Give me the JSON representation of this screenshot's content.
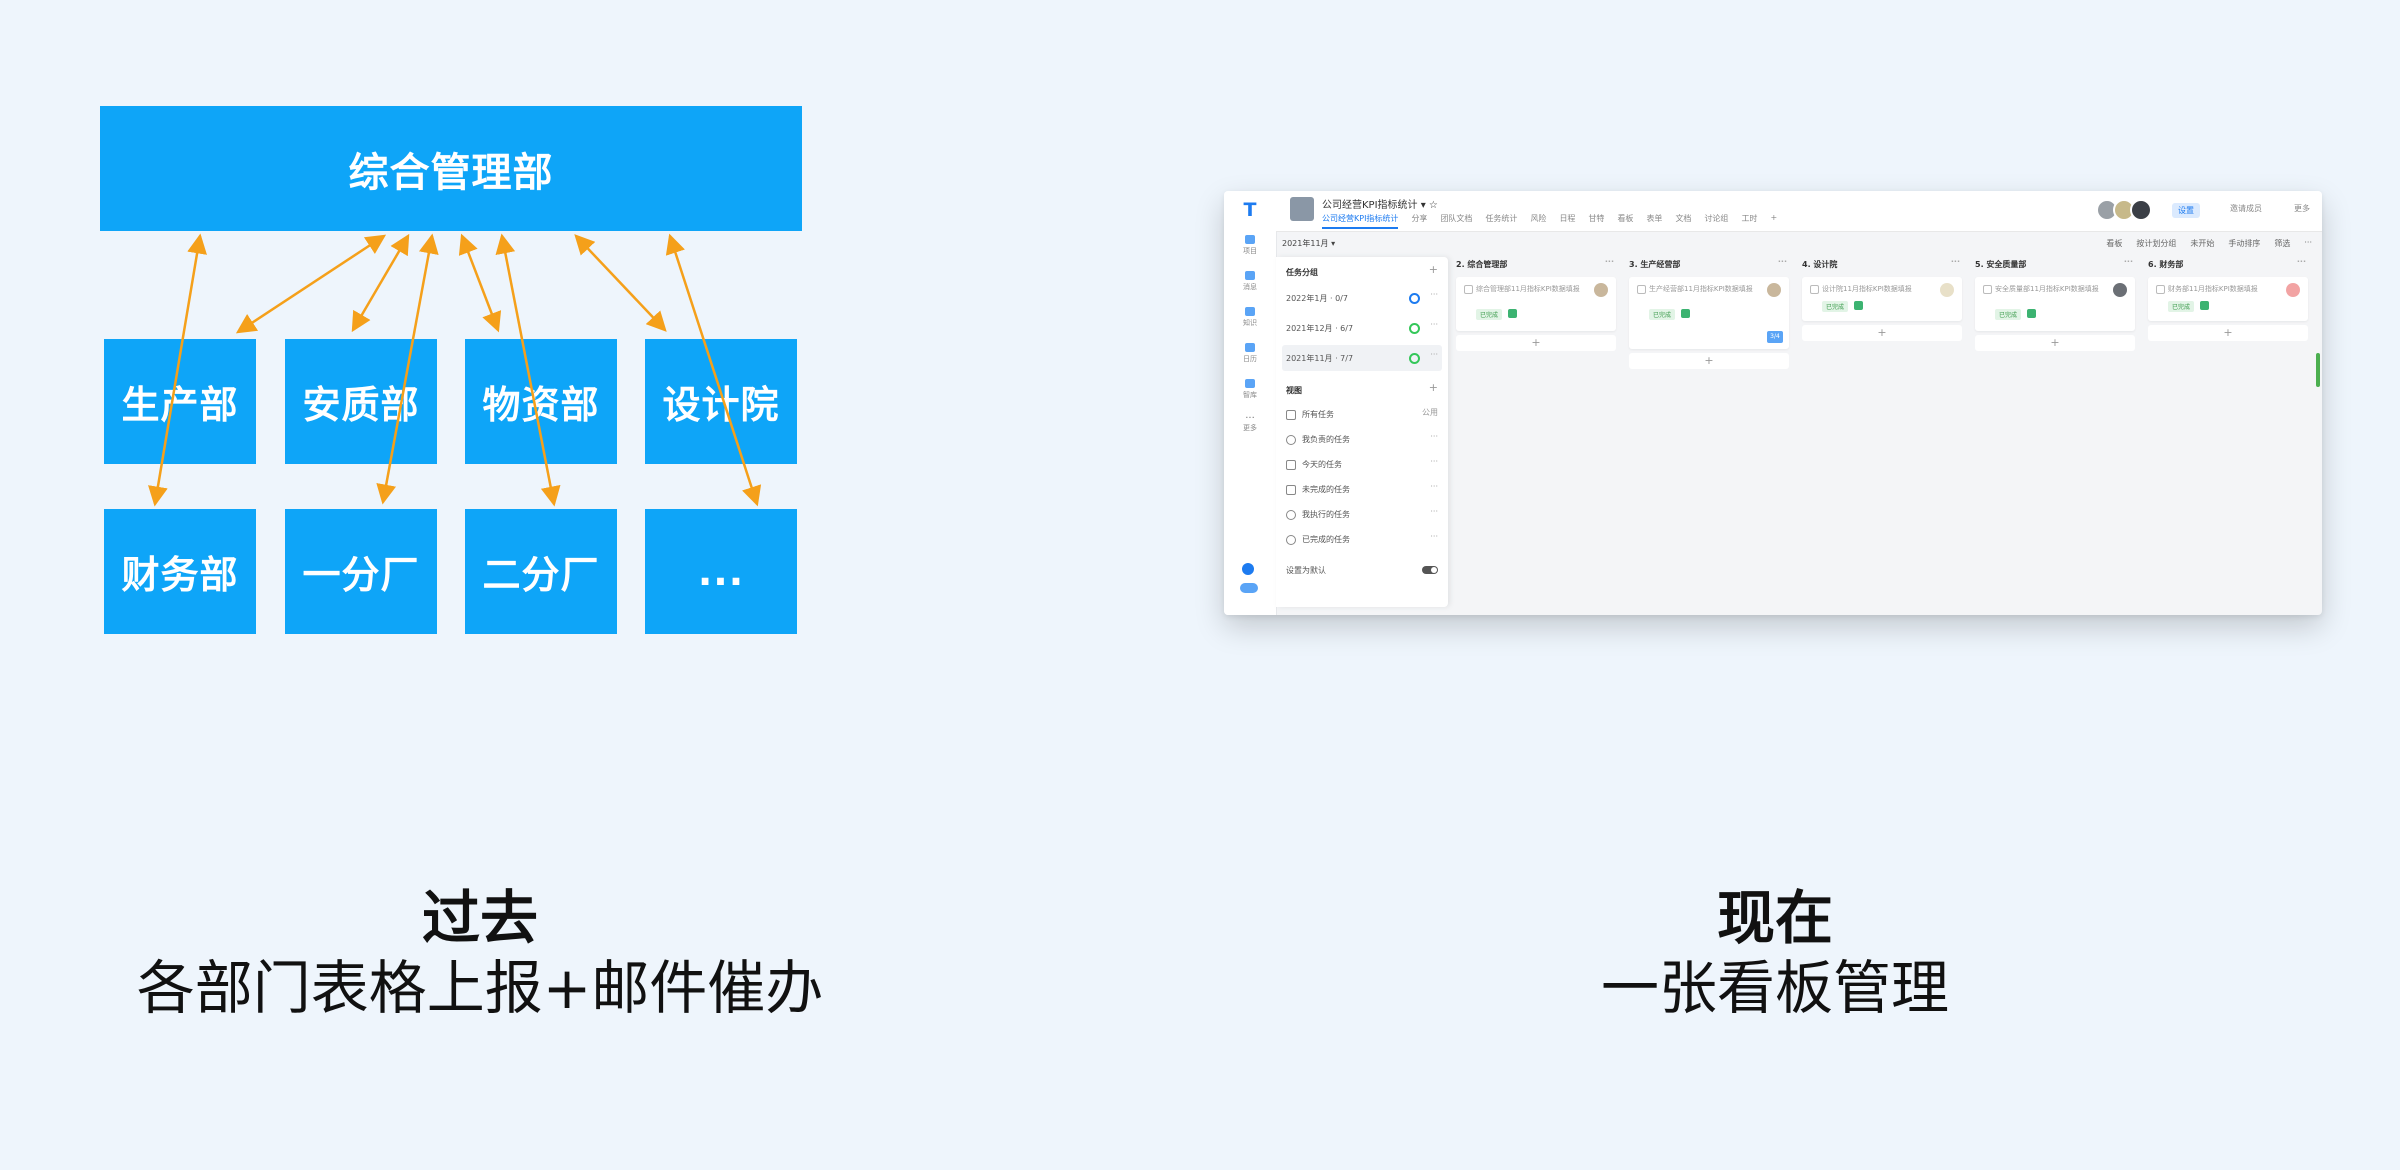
{
  "left": {
    "hq": "综合管理部",
    "row1": [
      "生产部",
      "安质部",
      "物资部",
      "设计院"
    ],
    "row2": [
      "财务部",
      "一分厂",
      "二分厂",
      "..."
    ],
    "caption_title": "过去",
    "caption_sub": "各部门表格上报+邮件催办",
    "arrow_color": "#f5a01a"
  },
  "right": {
    "caption_title": "现在",
    "caption_sub": "一张看板管理"
  },
  "screenshot": {
    "project_title": "公司经营KPI指标统计",
    "top_nav": [
      "公司经营KPI指标统计",
      "分享",
      "团队文档",
      "任务统计",
      "风险",
      "日程",
      "甘特",
      "看板",
      "表单",
      "文档",
      "讨论组",
      "工时",
      "+"
    ],
    "top_right": [
      "设置",
      "邀请成员",
      "更多"
    ],
    "month_filter": "2021年11月 ▾",
    "filters": [
      "看板",
      "按计划分组",
      "未开始",
      "手动排序",
      "筛选",
      "···"
    ],
    "task_group_header": "任务分组",
    "task_groups": [
      {
        "label": "2022年1月 · 0/7"
      },
      {
        "label": "2021年12月 · 6/7"
      },
      {
        "label": "2021年11月 · 7/7"
      }
    ],
    "views_header": "视图",
    "views": [
      {
        "label": "所有任务",
        "extra": "公用"
      },
      {
        "label": "我负责的任务",
        "extra": "···"
      },
      {
        "label": "今天的任务",
        "extra": "···"
      },
      {
        "label": "未完成的任务",
        "extra": "···"
      },
      {
        "label": "我执行的任务",
        "extra": "···"
      },
      {
        "label": "已完成的任务",
        "extra": "···"
      }
    ],
    "default_label": "设置为默认",
    "rail_items": [
      "项目",
      "消息",
      "知识",
      "日历",
      "智库",
      "更多"
    ],
    "columns": [
      {
        "title": "2. 综合管理部",
        "card": "综合管理部11月指标KPI数据填报",
        "tag": "已完成",
        "has_count": false
      },
      {
        "title": "3. 生产经营部",
        "card": "生产经营部11月指标KPI数据填报",
        "tag": "已完成",
        "has_count": true,
        "count": "3/4"
      },
      {
        "title": "4. 设计院",
        "card": "设计院11月指标KPI数据填报",
        "tag": "已完成",
        "has_count": false
      },
      {
        "title": "5. 安全质量部",
        "card": "安全质量部11月指标KPI数据填报",
        "tag": "已完成",
        "has_count": false
      },
      {
        "title": "6. 财务部",
        "card": "财务部11月指标KPI数据填报",
        "tag": "已完成",
        "has_count": false
      }
    ]
  }
}
